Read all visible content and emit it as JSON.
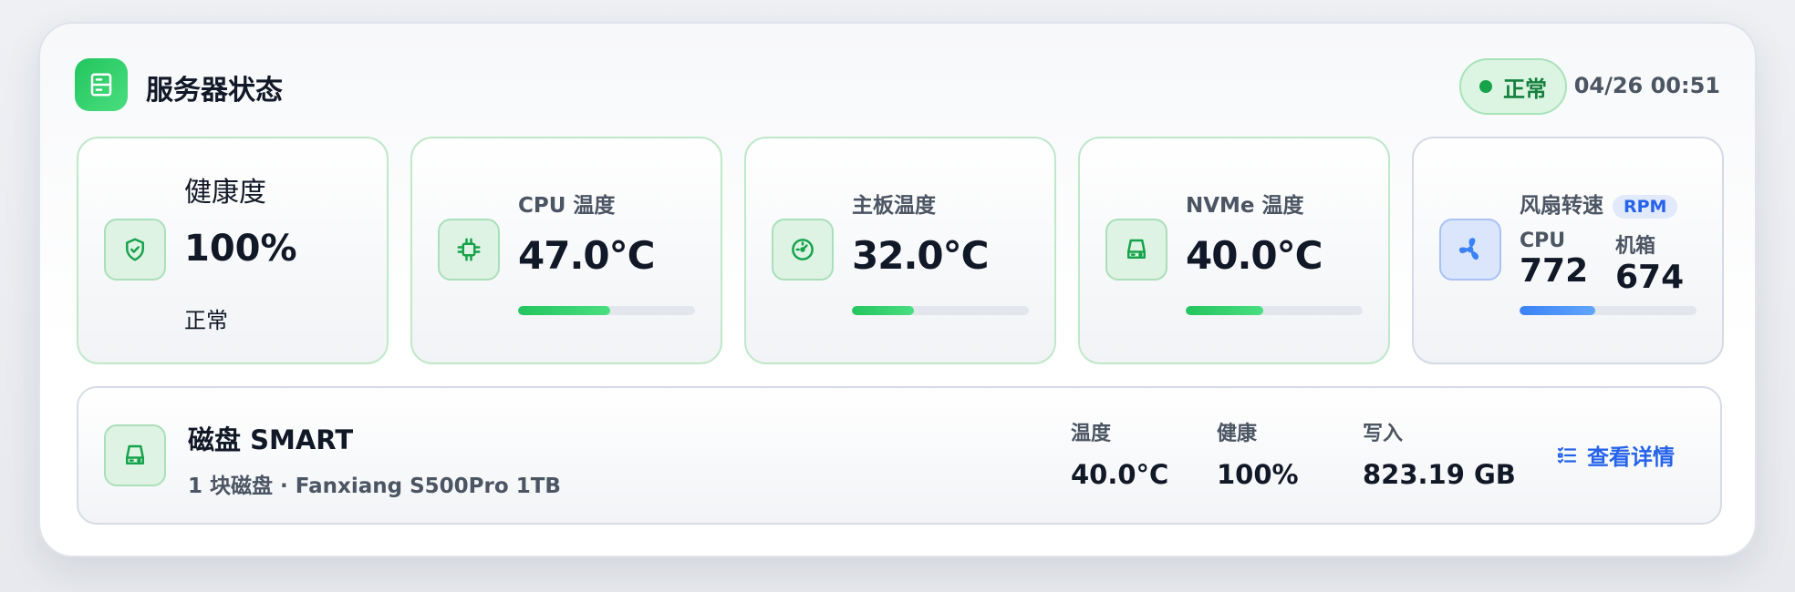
{
  "header": {
    "title": "服务器状态",
    "status": "正常",
    "datetime": "04/26 00:51",
    "icon": "server-icon"
  },
  "cards": {
    "health": {
      "label": "健康度",
      "value": "100%",
      "status": "正常",
      "icon": "shield-check-icon"
    },
    "cpu": {
      "label": "CPU 温度",
      "value": "47.0°C",
      "progress": 0.52,
      "icon": "chip-icon"
    },
    "board": {
      "label": "主板温度",
      "value": "32.0°C",
      "progress": 0.35,
      "icon": "gauge-icon"
    },
    "nvme": {
      "label": "NVMe 温度",
      "value": "40.0°C",
      "progress": 0.44,
      "icon": "drive-icon"
    },
    "fan": {
      "label": "风扇转速",
      "unit": "RPM",
      "cpu_label": "CPU",
      "cpu_value": "772",
      "case_label": "机箱",
      "case_value": "674",
      "progress": 0.43,
      "icon": "fan-icon"
    }
  },
  "disk": {
    "title": "磁盘 SMART",
    "subtitle": "1 块磁盘 · Fanxiang S500Pro 1TB",
    "temp_label": "温度",
    "temp_value": "40.0°C",
    "health_label": "健康",
    "health_value": "100%",
    "write_label": "写入",
    "write_value": "823.19 GB",
    "detail_link": "查看详情",
    "icon": "drive-icon"
  },
  "colors": {
    "accent_green": "#22c55e",
    "accent_blue": "#2563eb",
    "status_text": "#15803d"
  }
}
